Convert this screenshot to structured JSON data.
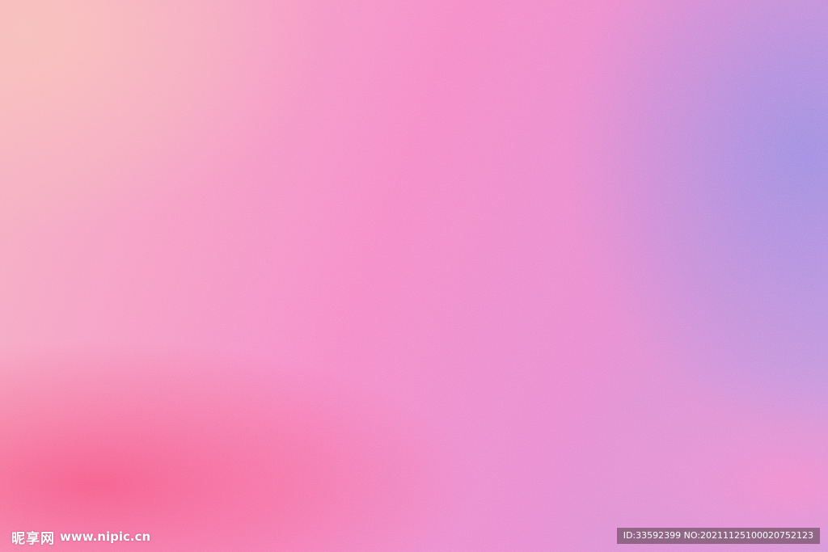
{
  "image": {
    "description_colors": {
      "top_left": "#f7bdb6",
      "center": "#f58ac8",
      "top_right": "#a58fe0",
      "bottom_left": "#f46090",
      "bottom_right": "#f28acb"
    }
  },
  "watermark": {
    "brand": "昵享网",
    "url": "www.nipic.cn"
  },
  "id_bar": {
    "text": "ID:33592399 NO:20211125100020752123"
  }
}
